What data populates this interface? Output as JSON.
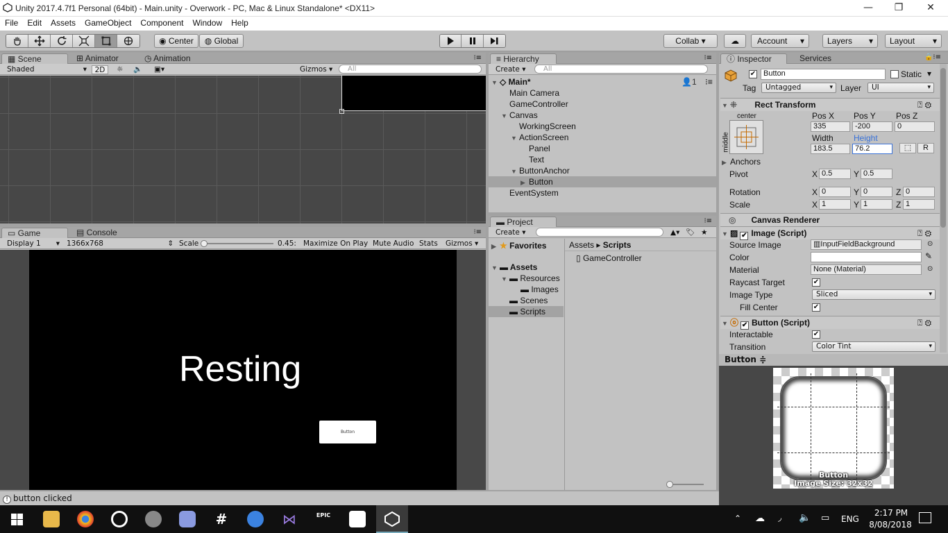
{
  "window": {
    "title": "Unity 2017.4.7f1 Personal (64bit) - Main.unity - Overwork - PC, Mac & Linux Standalone* <DX11>",
    "min": "—",
    "max": "❐",
    "close": "✕"
  },
  "menu": [
    "File",
    "Edit",
    "Assets",
    "GameObject",
    "Component",
    "Window",
    "Help"
  ],
  "toolbar": {
    "center": "Center",
    "global": "Global",
    "collab": "Collab ▾",
    "account": "Account",
    "layers": "Layers",
    "layout": "Layout"
  },
  "scene": {
    "tabs": {
      "scene": "Scene",
      "animator": "Animator",
      "animation": "Animation"
    },
    "shaded": "Shaded",
    "mode2d": "2D",
    "gizmos": "Gizmos ▾",
    "search": "All"
  },
  "game": {
    "tabs": {
      "game": "Game",
      "console": "Console"
    },
    "display": "Display 1",
    "resolution": "1366x768",
    "scale_label": "Scale",
    "scale_value": "0.45:",
    "maximize": "Maximize On Play",
    "mute": "Mute Audio",
    "stats": "Stats",
    "gizmos": "Gizmos ▾",
    "resting_text": "Resting",
    "button_text": "Button"
  },
  "hierarchy": {
    "tab": "Hierarchy",
    "create": "Create ▾",
    "search": "All",
    "scene": "Main*",
    "badge": "1",
    "items": [
      "Main Camera",
      "GameController",
      "Canvas",
      "WorkingScreen",
      "ActionScreen",
      "Panel",
      "Text",
      "ButtonAnchor",
      "Button",
      "EventSystem"
    ]
  },
  "project": {
    "tab": "Project",
    "create": "Create ▾",
    "favorites": "Favorites",
    "assets": "Assets",
    "resources": "Resources",
    "images": "Images",
    "scenes": "Scenes",
    "scripts": "Scripts",
    "breadcrumb_root": "Assets",
    "breadcrumb_sep": "▸",
    "breadcrumb_leaf": "Scripts",
    "file": "GameController"
  },
  "inspector": {
    "tab": "Inspector",
    "services": "Services",
    "name": "Button",
    "static": "Static",
    "tag_label": "Tag",
    "tag": "Untagged",
    "layer_label": "Layer",
    "layer": "UI",
    "rect": {
      "title": "Rect Transform",
      "anchor_h": "center",
      "anchor_v": "middle",
      "posx_label": "Pos X",
      "posy_label": "Pos Y",
      "posz_label": "Pos Z",
      "posx": "335",
      "posy": "-200",
      "posz": "0",
      "width_label": "Width",
      "height_label": "Height",
      "width": "183.5",
      "height": "76.2",
      "r": "R",
      "anchors": "Anchors",
      "pivot": "Pivot",
      "pivx": "0.5",
      "pivy": "0.5",
      "rotation": "Rotation",
      "rotx": "0",
      "roty": "0",
      "rotz": "0",
      "scale": "Scale",
      "sx": "1",
      "sy": "1",
      "sz": "1",
      "xl": "X",
      "yl": "Y",
      "zl": "Z"
    },
    "canvas_renderer": "Canvas Renderer",
    "image": {
      "title": "Image (Script)",
      "source_label": "Source Image",
      "source": "InputFieldBackground",
      "color_label": "Color",
      "material_label": "Material",
      "material": "None (Material)",
      "raycast": "Raycast Target",
      "type_label": "Image Type",
      "type": "Sliced",
      "fill": "Fill Center"
    },
    "button": {
      "title": "Button (Script)",
      "interactable": "Interactable",
      "transition_label": "Transition",
      "transition": "Color Tint"
    },
    "preview": {
      "title": "Button ≑",
      "label": "Button",
      "size": "Image Size: 32x32"
    }
  },
  "status": "button clicked",
  "taskbar": {
    "lang": "ENG",
    "time": "2:17 PM",
    "date": "8/08/2018"
  },
  "colors": {
    "accent": "#3a72d8",
    "panel": "#c2c2c2",
    "game_bg": "#000000"
  }
}
